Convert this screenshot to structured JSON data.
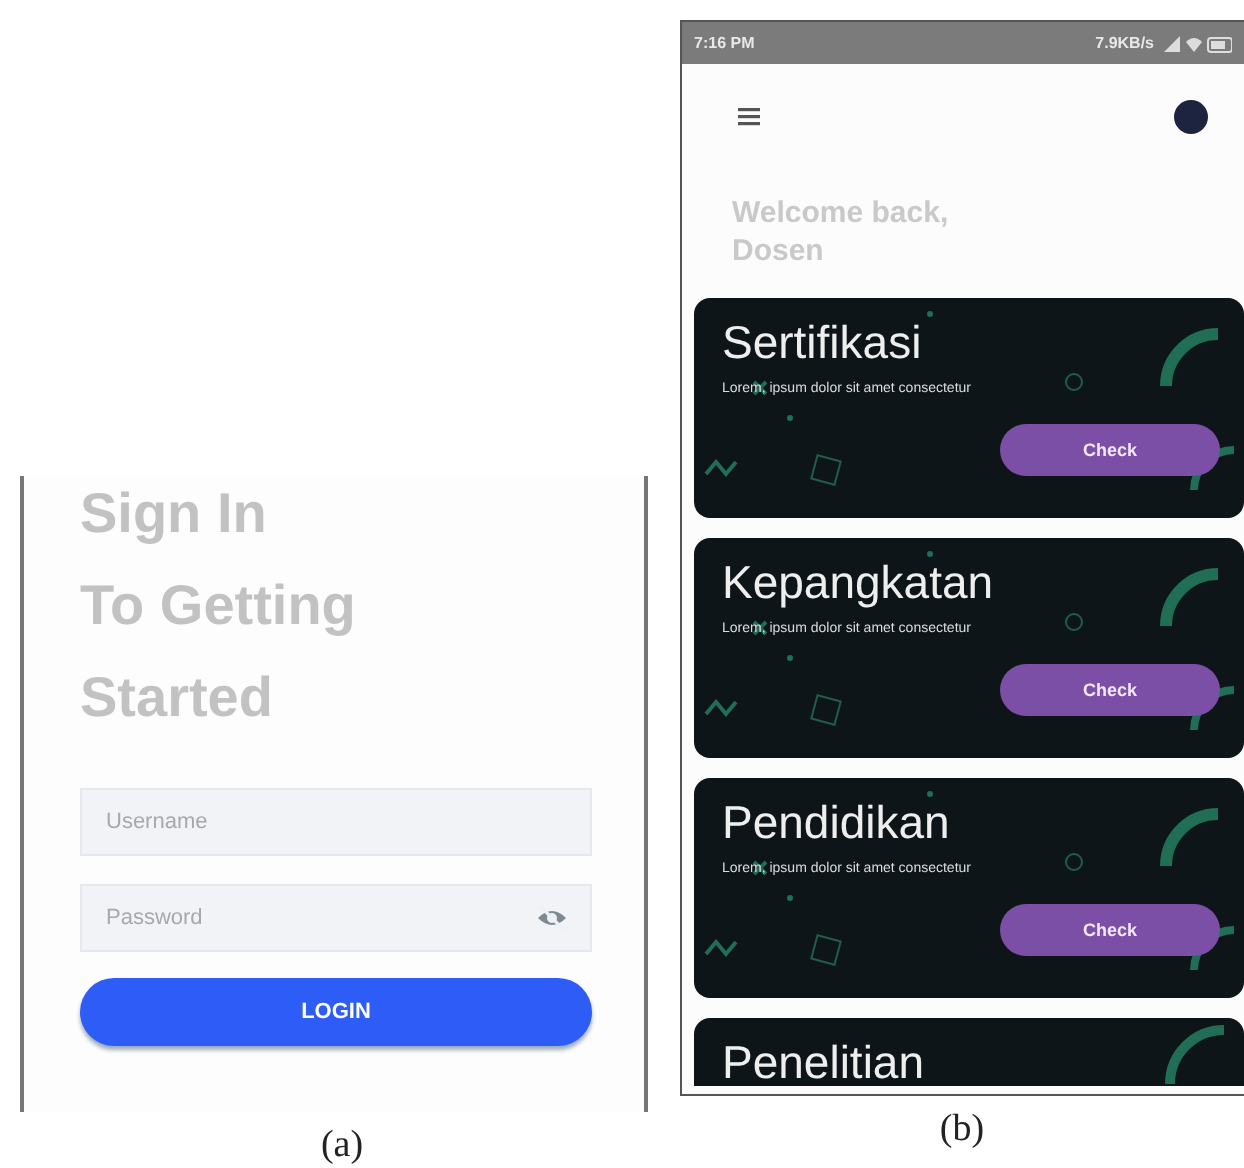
{
  "figure_a": {
    "heading_lines": [
      "Sign In",
      "To Getting",
      "Started"
    ],
    "username": {
      "placeholder": "Username"
    },
    "password": {
      "placeholder": "Password"
    },
    "login_button": "LOGIN",
    "caption": "(a)"
  },
  "figure_b": {
    "status_bar": {
      "time": "7:16 PM",
      "speed": "7.9KB/s"
    },
    "greeting_lines": [
      "Welcome back,",
      "Dosen"
    ],
    "cards": [
      {
        "title": "Sertifikasi",
        "description": "Lorem, ipsum dolor sit amet consectetur",
        "button": "Check"
      },
      {
        "title": "Kepangkatan",
        "description": "Lorem, ipsum dolor sit amet consectetur",
        "button": "Check"
      },
      {
        "title": "Pendidikan",
        "description": "Lorem, ipsum dolor sit amet consectetur",
        "button": "Check"
      },
      {
        "title": "Penelitian"
      }
    ],
    "caption": "(b)"
  }
}
